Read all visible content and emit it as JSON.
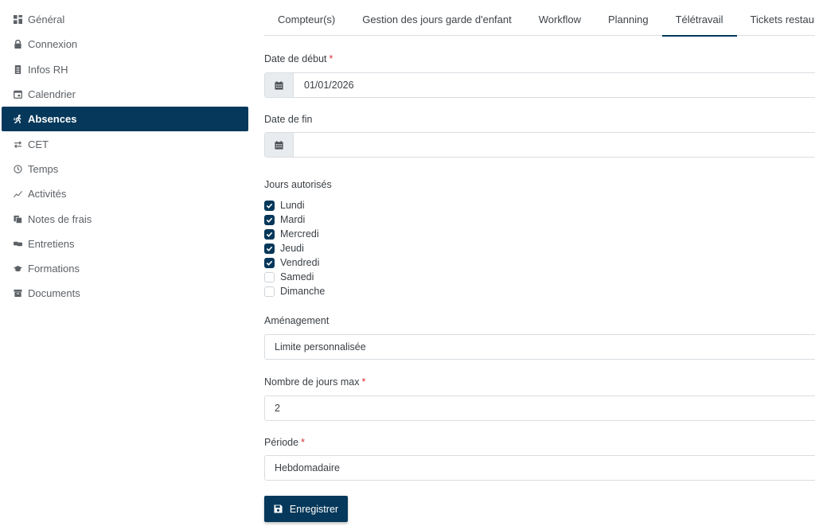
{
  "sidebar": {
    "items": [
      {
        "label": "Général",
        "icon": "dashboard-icon"
      },
      {
        "label": "Connexion",
        "icon": "lock-icon"
      },
      {
        "label": "Infos RH",
        "icon": "id-card-icon"
      },
      {
        "label": "Calendrier",
        "icon": "calendar-icon"
      },
      {
        "label": "Absences",
        "icon": "walking-person-icon",
        "active": true
      },
      {
        "label": "CET",
        "icon": "exchange-arrows-icon"
      },
      {
        "label": "Temps",
        "icon": "clock-icon"
      },
      {
        "label": "Activités",
        "icon": "trend-line-icon"
      },
      {
        "label": "Notes de frais",
        "icon": "receipts-icon"
      },
      {
        "label": "Entretiens",
        "icon": "conversation-icon"
      },
      {
        "label": "Formations",
        "icon": "graduation-cap-icon"
      },
      {
        "label": "Documents",
        "icon": "archive-box-icon"
      }
    ]
  },
  "tabs": {
    "items": [
      {
        "label": "Compteur(s)"
      },
      {
        "label": "Gestion des jours garde d'enfant"
      },
      {
        "label": "Workflow"
      },
      {
        "label": "Planning"
      },
      {
        "label": "Télétravail",
        "active": true
      },
      {
        "label": "Tickets restaurant"
      }
    ]
  },
  "form": {
    "start_date": {
      "label": "Date de début",
      "required_mark": "*",
      "value": "01/01/2026"
    },
    "end_date": {
      "label": "Date de fin",
      "value": ""
    },
    "allowed_days": {
      "label": "Jours autorisés",
      "days": [
        {
          "label": "Lundi",
          "checked": true
        },
        {
          "label": "Mardi",
          "checked": true
        },
        {
          "label": "Mercredi",
          "checked": true
        },
        {
          "label": "Jeudi",
          "checked": true
        },
        {
          "label": "Vendredi",
          "checked": true
        },
        {
          "label": "Samedi",
          "checked": false
        },
        {
          "label": "Dimanche",
          "checked": false
        }
      ]
    },
    "arrangement": {
      "label": "Aménagement",
      "value": "Limite personnalisée"
    },
    "max_days": {
      "label": "Nombre de jours max",
      "required_mark": "*",
      "value": "2"
    },
    "period": {
      "label": "Période",
      "required_mark": "*",
      "value": "Hebdomadaire"
    },
    "save_label": "Enregistrer"
  },
  "colors": {
    "accent": "#05385a",
    "required": "#d9303a",
    "addon_bg": "#e9ecef",
    "border": "#d9dde1"
  }
}
